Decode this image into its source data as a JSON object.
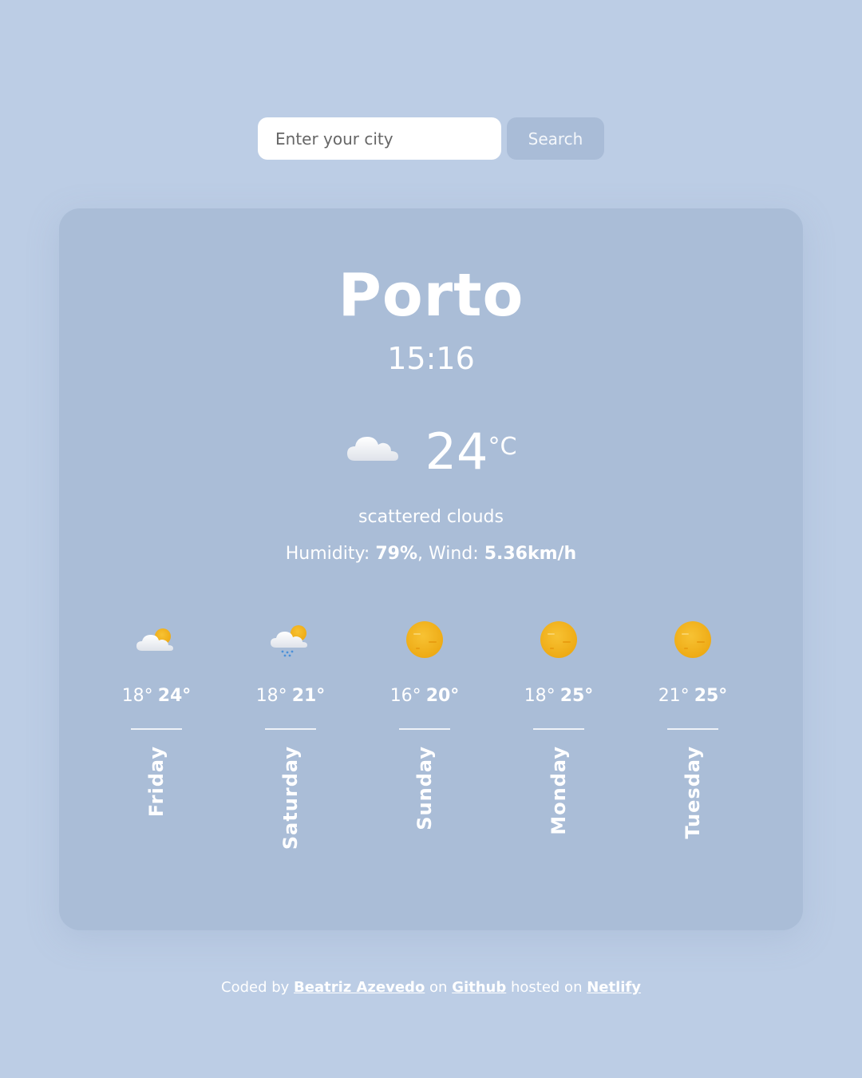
{
  "search": {
    "placeholder": "Enter your city",
    "button_label": "Search"
  },
  "current": {
    "city": "Porto",
    "time": "15:16",
    "icon": "cloud-icon",
    "temperature": "24",
    "unit": "°C",
    "description": "scattered clouds",
    "humidity_label": "Humidity: ",
    "humidity_value": "79%",
    "wind_label": ", Wind: ",
    "wind_value": "5.36km/h"
  },
  "forecast": [
    {
      "day": "Friday",
      "min": "18°",
      "max": "24°",
      "icon": "partly-cloudy-icon"
    },
    {
      "day": "Saturday",
      "min": "18°",
      "max": "21°",
      "icon": "rain-cloud-sun-icon"
    },
    {
      "day": "Sunday",
      "min": "16°",
      "max": "20°",
      "icon": "sun-icon"
    },
    {
      "day": "Monday",
      "min": "18°",
      "max": "25°",
      "icon": "sun-icon"
    },
    {
      "day": "Tuesday",
      "min": "21°",
      "max": "25°",
      "icon": "sun-icon"
    }
  ],
  "footer": {
    "prefix": "Coded by ",
    "author": "Beatriz Azevedo",
    "on": " on ",
    "github": "Github",
    "hosted": " hosted on ",
    "netlify": "Netlify"
  },
  "colors": {
    "background": "#bccde5",
    "card": "#aabdd7",
    "sun": "#f5b81f",
    "button": "#a9bcd7"
  }
}
